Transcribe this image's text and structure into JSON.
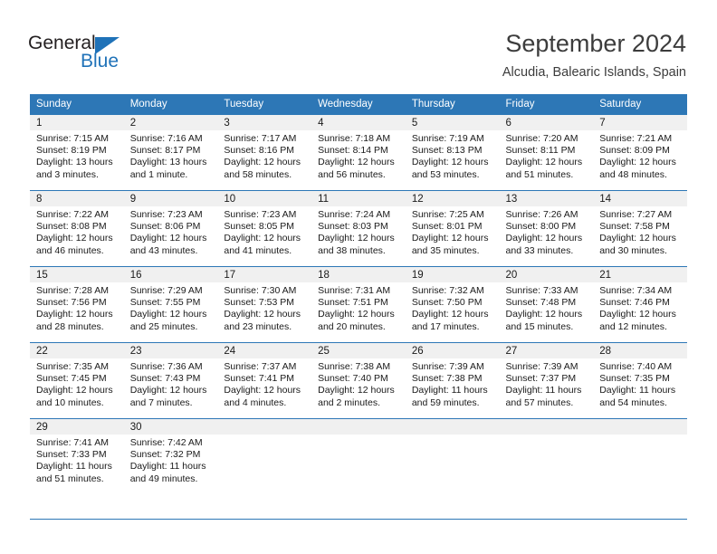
{
  "brand": {
    "name_dark": "General",
    "name_blue": "Blue",
    "accent_color": "#1f72b8"
  },
  "header": {
    "title": "September 2024",
    "location": "Alcudia, Balearic Islands, Spain"
  },
  "calendar": {
    "header_bg": "#2d77b6",
    "daynum_bg": "#f0f0f0",
    "weekday_headers": [
      "Sunday",
      "Monday",
      "Tuesday",
      "Wednesday",
      "Thursday",
      "Friday",
      "Saturday"
    ],
    "weeks": [
      [
        {
          "day": "1",
          "sunrise": "Sunrise: 7:15 AM",
          "sunset": "Sunset: 8:19 PM",
          "daylight_line1": "Daylight: 13 hours",
          "daylight_line2": "and 3 minutes."
        },
        {
          "day": "2",
          "sunrise": "Sunrise: 7:16 AM",
          "sunset": "Sunset: 8:17 PM",
          "daylight_line1": "Daylight: 13 hours",
          "daylight_line2": "and 1 minute."
        },
        {
          "day": "3",
          "sunrise": "Sunrise: 7:17 AM",
          "sunset": "Sunset: 8:16 PM",
          "daylight_line1": "Daylight: 12 hours",
          "daylight_line2": "and 58 minutes."
        },
        {
          "day": "4",
          "sunrise": "Sunrise: 7:18 AM",
          "sunset": "Sunset: 8:14 PM",
          "daylight_line1": "Daylight: 12 hours",
          "daylight_line2": "and 56 minutes."
        },
        {
          "day": "5",
          "sunrise": "Sunrise: 7:19 AM",
          "sunset": "Sunset: 8:13 PM",
          "daylight_line1": "Daylight: 12 hours",
          "daylight_line2": "and 53 minutes."
        },
        {
          "day": "6",
          "sunrise": "Sunrise: 7:20 AM",
          "sunset": "Sunset: 8:11 PM",
          "daylight_line1": "Daylight: 12 hours",
          "daylight_line2": "and 51 minutes."
        },
        {
          "day": "7",
          "sunrise": "Sunrise: 7:21 AM",
          "sunset": "Sunset: 8:09 PM",
          "daylight_line1": "Daylight: 12 hours",
          "daylight_line2": "and 48 minutes."
        }
      ],
      [
        {
          "day": "8",
          "sunrise": "Sunrise: 7:22 AM",
          "sunset": "Sunset: 8:08 PM",
          "daylight_line1": "Daylight: 12 hours",
          "daylight_line2": "and 46 minutes."
        },
        {
          "day": "9",
          "sunrise": "Sunrise: 7:23 AM",
          "sunset": "Sunset: 8:06 PM",
          "daylight_line1": "Daylight: 12 hours",
          "daylight_line2": "and 43 minutes."
        },
        {
          "day": "10",
          "sunrise": "Sunrise: 7:23 AM",
          "sunset": "Sunset: 8:05 PM",
          "daylight_line1": "Daylight: 12 hours",
          "daylight_line2": "and 41 minutes."
        },
        {
          "day": "11",
          "sunrise": "Sunrise: 7:24 AM",
          "sunset": "Sunset: 8:03 PM",
          "daylight_line1": "Daylight: 12 hours",
          "daylight_line2": "and 38 minutes."
        },
        {
          "day": "12",
          "sunrise": "Sunrise: 7:25 AM",
          "sunset": "Sunset: 8:01 PM",
          "daylight_line1": "Daylight: 12 hours",
          "daylight_line2": "and 35 minutes."
        },
        {
          "day": "13",
          "sunrise": "Sunrise: 7:26 AM",
          "sunset": "Sunset: 8:00 PM",
          "daylight_line1": "Daylight: 12 hours",
          "daylight_line2": "and 33 minutes."
        },
        {
          "day": "14",
          "sunrise": "Sunrise: 7:27 AM",
          "sunset": "Sunset: 7:58 PM",
          "daylight_line1": "Daylight: 12 hours",
          "daylight_line2": "and 30 minutes."
        }
      ],
      [
        {
          "day": "15",
          "sunrise": "Sunrise: 7:28 AM",
          "sunset": "Sunset: 7:56 PM",
          "daylight_line1": "Daylight: 12 hours",
          "daylight_line2": "and 28 minutes."
        },
        {
          "day": "16",
          "sunrise": "Sunrise: 7:29 AM",
          "sunset": "Sunset: 7:55 PM",
          "daylight_line1": "Daylight: 12 hours",
          "daylight_line2": "and 25 minutes."
        },
        {
          "day": "17",
          "sunrise": "Sunrise: 7:30 AM",
          "sunset": "Sunset: 7:53 PM",
          "daylight_line1": "Daylight: 12 hours",
          "daylight_line2": "and 23 minutes."
        },
        {
          "day": "18",
          "sunrise": "Sunrise: 7:31 AM",
          "sunset": "Sunset: 7:51 PM",
          "daylight_line1": "Daylight: 12 hours",
          "daylight_line2": "and 20 minutes."
        },
        {
          "day": "19",
          "sunrise": "Sunrise: 7:32 AM",
          "sunset": "Sunset: 7:50 PM",
          "daylight_line1": "Daylight: 12 hours",
          "daylight_line2": "and 17 minutes."
        },
        {
          "day": "20",
          "sunrise": "Sunrise: 7:33 AM",
          "sunset": "Sunset: 7:48 PM",
          "daylight_line1": "Daylight: 12 hours",
          "daylight_line2": "and 15 minutes."
        },
        {
          "day": "21",
          "sunrise": "Sunrise: 7:34 AM",
          "sunset": "Sunset: 7:46 PM",
          "daylight_line1": "Daylight: 12 hours",
          "daylight_line2": "and 12 minutes."
        }
      ],
      [
        {
          "day": "22",
          "sunrise": "Sunrise: 7:35 AM",
          "sunset": "Sunset: 7:45 PM",
          "daylight_line1": "Daylight: 12 hours",
          "daylight_line2": "and 10 minutes."
        },
        {
          "day": "23",
          "sunrise": "Sunrise: 7:36 AM",
          "sunset": "Sunset: 7:43 PM",
          "daylight_line1": "Daylight: 12 hours",
          "daylight_line2": "and 7 minutes."
        },
        {
          "day": "24",
          "sunrise": "Sunrise: 7:37 AM",
          "sunset": "Sunset: 7:41 PM",
          "daylight_line1": "Daylight: 12 hours",
          "daylight_line2": "and 4 minutes."
        },
        {
          "day": "25",
          "sunrise": "Sunrise: 7:38 AM",
          "sunset": "Sunset: 7:40 PM",
          "daylight_line1": "Daylight: 12 hours",
          "daylight_line2": "and 2 minutes."
        },
        {
          "day": "26",
          "sunrise": "Sunrise: 7:39 AM",
          "sunset": "Sunset: 7:38 PM",
          "daylight_line1": "Daylight: 11 hours",
          "daylight_line2": "and 59 minutes."
        },
        {
          "day": "27",
          "sunrise": "Sunrise: 7:39 AM",
          "sunset": "Sunset: 7:37 PM",
          "daylight_line1": "Daylight: 11 hours",
          "daylight_line2": "and 57 minutes."
        },
        {
          "day": "28",
          "sunrise": "Sunrise: 7:40 AM",
          "sunset": "Sunset: 7:35 PM",
          "daylight_line1": "Daylight: 11 hours",
          "daylight_line2": "and 54 minutes."
        }
      ],
      [
        {
          "day": "29",
          "sunrise": "Sunrise: 7:41 AM",
          "sunset": "Sunset: 7:33 PM",
          "daylight_line1": "Daylight: 11 hours",
          "daylight_line2": "and 51 minutes."
        },
        {
          "day": "30",
          "sunrise": "Sunrise: 7:42 AM",
          "sunset": "Sunset: 7:32 PM",
          "daylight_line1": "Daylight: 11 hours",
          "daylight_line2": "and 49 minutes."
        },
        {
          "day": "",
          "sunrise": "",
          "sunset": "",
          "daylight_line1": "",
          "daylight_line2": ""
        },
        {
          "day": "",
          "sunrise": "",
          "sunset": "",
          "daylight_line1": "",
          "daylight_line2": ""
        },
        {
          "day": "",
          "sunrise": "",
          "sunset": "",
          "daylight_line1": "",
          "daylight_line2": ""
        },
        {
          "day": "",
          "sunrise": "",
          "sunset": "",
          "daylight_line1": "",
          "daylight_line2": ""
        },
        {
          "day": "",
          "sunrise": "",
          "sunset": "",
          "daylight_line1": "",
          "daylight_line2": ""
        }
      ]
    ]
  }
}
